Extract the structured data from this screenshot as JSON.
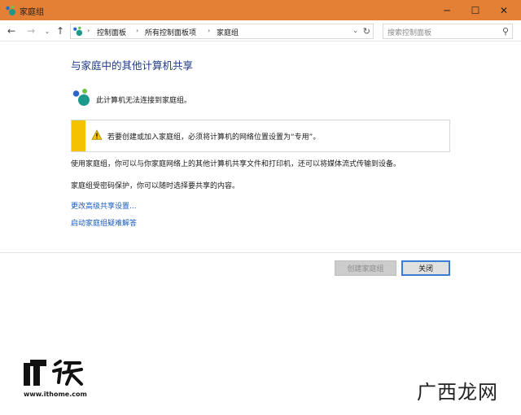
{
  "window": {
    "title": "家庭组",
    "minimize_glyph": "─",
    "maximize_glyph": "☐",
    "close_glyph": "✕"
  },
  "nav": {
    "back_glyph": "←",
    "forward_glyph": "→",
    "history_glyph": "⌄",
    "up_glyph": "↑",
    "breadcrumbs": [
      "控制面板",
      "所有控制面板项",
      "家庭组"
    ],
    "separator_glyph": "›",
    "dropdown_glyph": "⌄",
    "refresh_glyph": "↻",
    "search_placeholder": "搜索控制面板",
    "search_glyph": "⚲"
  },
  "main": {
    "heading": "与家庭中的其他计算机共享",
    "status_text": "此计算机无法连接到家庭组。",
    "warning_text": "若要创建或加入家庭组，必须将计算机的网络位置设置为“专用”。",
    "description_1": "使用家庭组，你可以与你家庭网络上的其他计算机共享文件和打印机，还可以将媒体流式传输到设备。",
    "description_2": "家庭组受密码保护，你可以随时选择要共享的内容。",
    "links": [
      "更改高级共享设置...",
      "启动家庭组疑难解答"
    ]
  },
  "buttons": {
    "create_label": "创建家庭组",
    "close_label": "关闭"
  },
  "watermark": {
    "site": "www.ithome.com",
    "brand": "广西龙网"
  },
  "colors": {
    "titlebar": "#e47f36",
    "heading": "#1e3a8a",
    "link": "#1a5bbf",
    "warning_bar": "#f5c200",
    "button_focus": "#3b7bd6"
  }
}
